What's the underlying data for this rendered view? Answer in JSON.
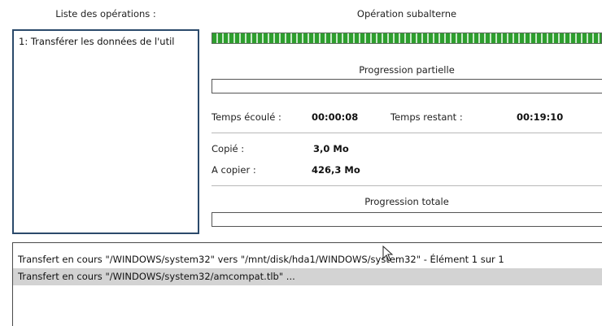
{
  "left_panel": {
    "header": "Liste des opérations :",
    "items": [
      {
        "label": "1: Transférer les données de l'util"
      }
    ]
  },
  "right_panel": {
    "sub_header": "Opération subalterne",
    "sub_progress_fraction": 1.0,
    "partial_title": "Progression partielle",
    "partial_progress_fraction": 0.0,
    "elapsed_label": "Temps écoulé :",
    "elapsed_value": "00:00:08",
    "remaining_label": "Temps restant :",
    "remaining_value": "00:19:10",
    "copied_label": "Copié :",
    "copied_value": "3,0 Mo",
    "to_copy_label": "A copier :",
    "to_copy_value": "426,3 Mo",
    "total_title": "Progression totale",
    "total_progress_fraction": 0.0
  },
  "log": {
    "lines": [
      {
        "text": "Transfert en cours \"/WINDOWS/system32\" vers \"/mnt/disk/hda1/WINDOWS/system32\" - Élément 1 sur 1",
        "selected": false
      },
      {
        "text": "Transfert en cours \"/WINDOWS/system32/amcompat.tlb\" ...",
        "selected": true
      }
    ]
  },
  "colors": {
    "progress_green": "#2e9e2e",
    "list_border": "#2b4a6b",
    "selection_gray": "#d3d3d3"
  },
  "icons": {
    "cursor": "mouse-pointer-icon"
  }
}
